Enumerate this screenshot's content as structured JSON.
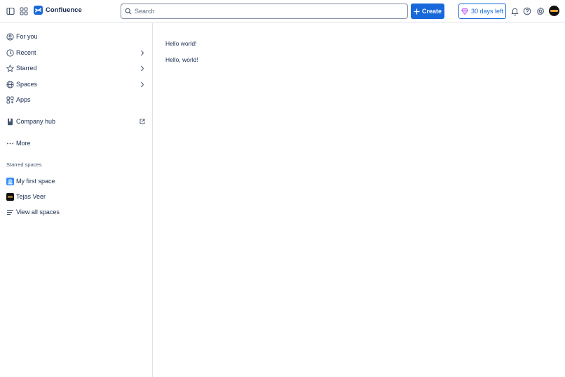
{
  "header": {
    "app_name": "Confluence",
    "search_placeholder": "Search",
    "create_label": "Create",
    "trial_label": "30 days left"
  },
  "sidebar": {
    "items": [
      {
        "label": "For you",
        "icon": "for-you-icon"
      },
      {
        "label": "Recent",
        "icon": "clock-icon",
        "chevron": true
      },
      {
        "label": "Starred",
        "icon": "star-icon",
        "chevron": true
      },
      {
        "label": "Spaces",
        "icon": "globe-icon",
        "chevron": true
      },
      {
        "label": "Apps",
        "icon": "apps-icon"
      },
      {
        "label": "Company hub",
        "icon": "bookmark-icon",
        "external": true
      },
      {
        "label": "More",
        "icon": "more-icon"
      }
    ],
    "starred_spaces_title": "Starred spaces",
    "starred_spaces": [
      {
        "label": "My first space",
        "icon": "space-avatar-icon"
      },
      {
        "label": "Tejas Veer",
        "icon": "personal-space-icon"
      }
    ],
    "view_all_label": "View all spaces"
  },
  "main": {
    "lines": [
      "Hello world!",
      "Hello, world!"
    ]
  },
  "colors": {
    "brand": "#1868db",
    "text": "#172b4d",
    "subtle": "#44546f",
    "border": "#dfe1e6",
    "trial_gem": "#bf63f3"
  }
}
